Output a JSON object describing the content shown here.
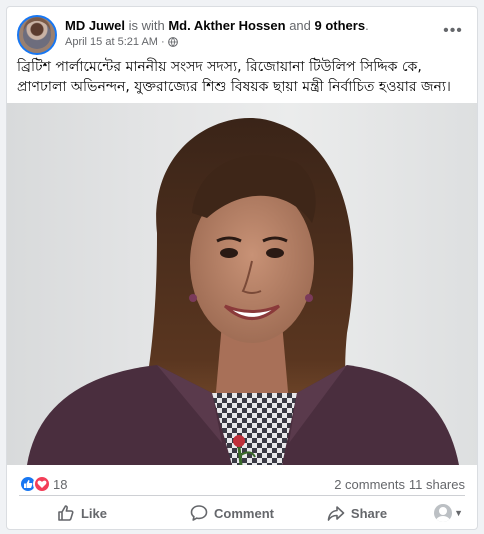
{
  "post": {
    "author": "MD Juwel",
    "with_text": " is with ",
    "tagged_person": "Md. Akther Hossen",
    "and_text": " and ",
    "others": "9 others",
    "period": ".",
    "timestamp": "April 15 at 5:21 AM",
    "separator": "·",
    "more_label": "•••",
    "text": "ব্রিটিশ পার্লামেন্টের মাননীয় সংসদ সদস্য, রিজোয়ানা টিউলিপ সিদ্দিক কে, প্রাণঢালা অভিনন্দন, যুক্তরাজ্যের শিশু বিষয়ক ছায়া মন্ত্রী নির্বাচিত হওয়ার জন্য।"
  },
  "stats": {
    "reactions_count": "18",
    "comments": "2 comments",
    "shares": "11 shares"
  },
  "actions": {
    "like": "Like",
    "comment": "Comment",
    "share": "Share"
  },
  "colors": {
    "facebook_blue": "#1877f2",
    "love_red": "#f33e58",
    "muted_text": "#65676b"
  }
}
